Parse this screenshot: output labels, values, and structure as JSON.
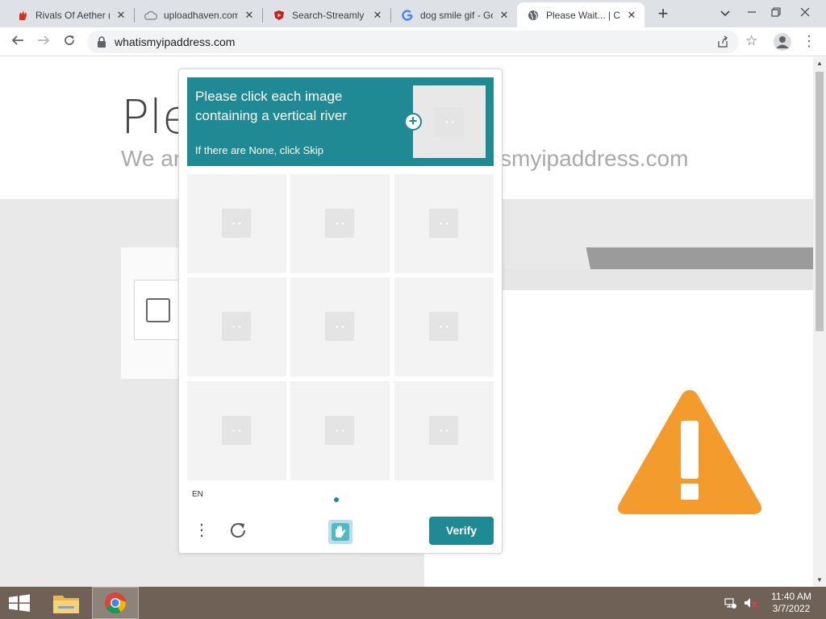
{
  "browser": {
    "tabs": [
      {
        "title": "Rivals Of Aether (",
        "favicon": "red-hand-icon",
        "active": false
      },
      {
        "title": "uploadhaven.com",
        "favicon": "cloud-icon",
        "active": false
      },
      {
        "title": "Search-Streamly",
        "favicon": "streamly-shield-icon",
        "active": false
      },
      {
        "title": "dog smile gif - Go",
        "favicon": "google-icon",
        "active": false
      },
      {
        "title": "Please Wait... | Clo",
        "favicon": "globe-icon",
        "active": true
      }
    ],
    "tab_close_glyph": "✕",
    "new_tab_glyph": "+",
    "url": "whatismyipaddress.com"
  },
  "page": {
    "title": "Ple",
    "subtitle_left": "We ar",
    "subtitle_right": "smyipaddress.com"
  },
  "captcha": {
    "prompt": "Please click each image containing a vertical river",
    "hint": "If there are None, click Skip",
    "language": "EN",
    "verify_label": "Verify",
    "accent_color": "#1f8a93",
    "grid_cells": 9
  },
  "taskbar": {
    "time": "11:40 AM",
    "date": "3/7/2022"
  }
}
